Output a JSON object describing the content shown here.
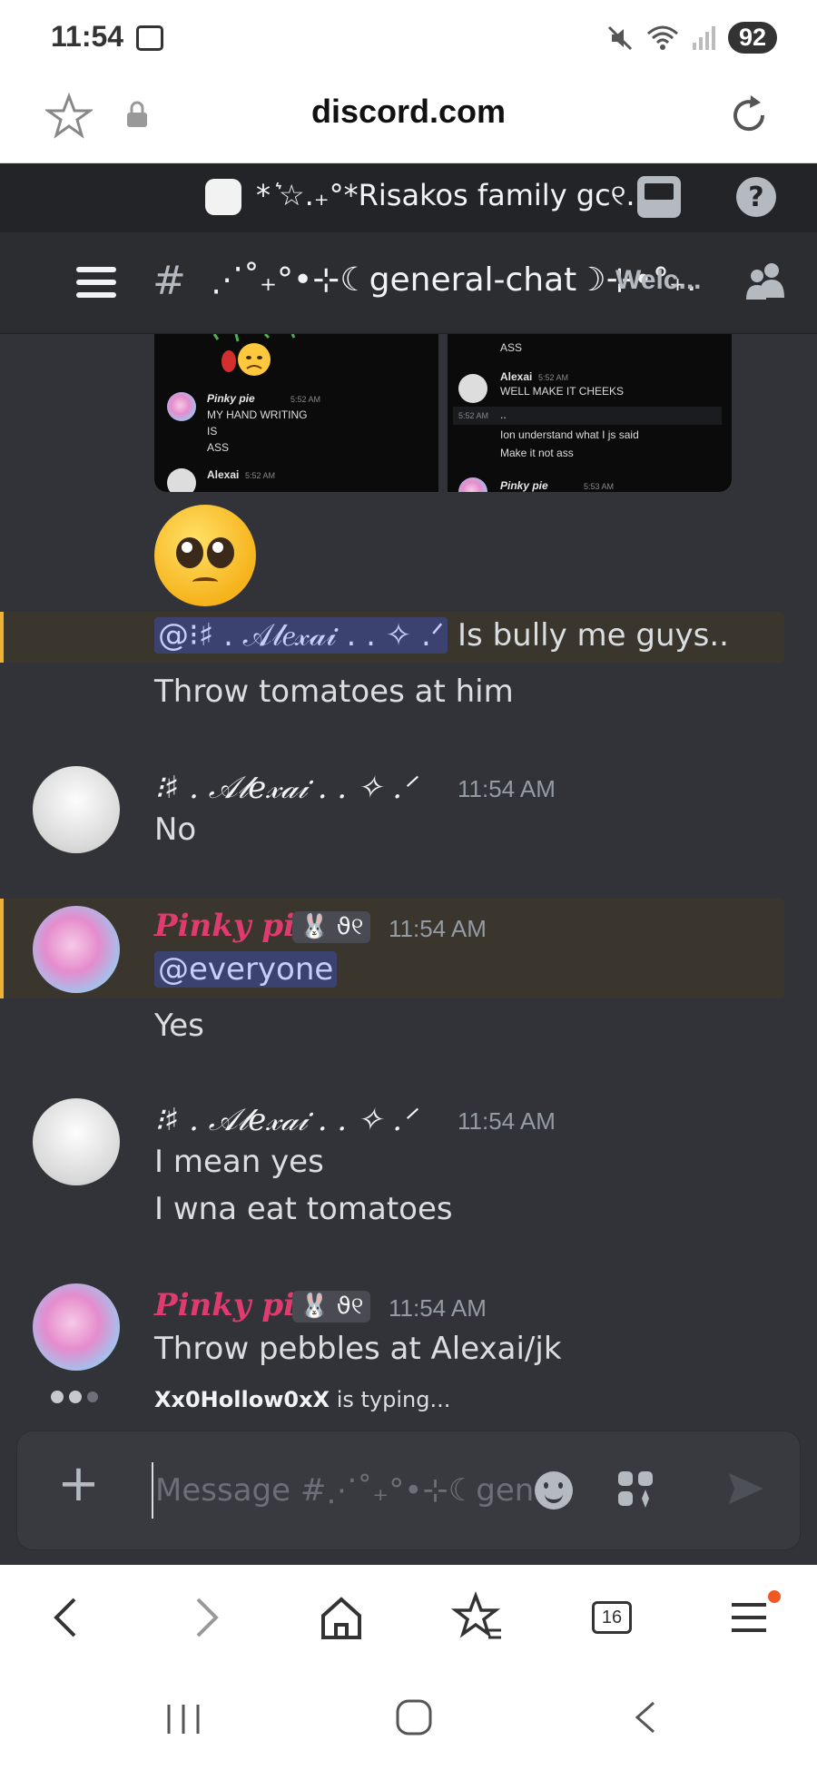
{
  "status_bar": {
    "time": "11:54",
    "battery": "92"
  },
  "browser": {
    "url": "discord.com",
    "tab_count": "16"
  },
  "server": {
    "name": "* ͛☆.₊°*Risakos family gc୧..."
  },
  "channel": {
    "hash": "#",
    "name": "⋰˚₊°•⊹☾general-chat☽⊹•°₊.",
    "topic": "Welc..."
  },
  "preview_images": {
    "left": {
      "author": "Pinky pie",
      "time": "5:52 AM",
      "lines": [
        "MY HAND WRITING",
        "IS",
        "ASS"
      ],
      "next_author": "Alexai",
      "next_time": "5:52 AM"
    },
    "right": {
      "top_line": "ASS",
      "author": "Alexai",
      "time": "5:52 AM",
      "line1": "WELL MAKE IT CHEEKS",
      "gap_time": "5:52 AM",
      "dots": "..",
      "line2": "Ion understand what I js said",
      "line3": "Make it not ass",
      "next_author": "Pinky pie",
      "next_time": "5:53 AM"
    }
  },
  "messages": {
    "m1": {
      "mention": "@⁝♯ . 𝒜𝓁𝑒𝓍𝒶𝒾 . . ✧ .ᐟ",
      "text": " Is bully me guys..",
      "line2": "Throw tomatoes at him"
    },
    "m2": {
      "author": "⁝♯ . 𝒜𝓁𝑒𝓍𝒶𝒾 . . ✧ .ᐟ",
      "time": "11:54 AM",
      "text": "No"
    },
    "m3": {
      "author": "Pinky pie",
      "tag": "🐰 ϑ୧",
      "time": "11:54 AM",
      "mention": "@everyone",
      "line2": "Yes"
    },
    "m4": {
      "author": "⁝♯ . 𝒜𝓁𝑒𝓍𝒶𝒾 . . ✧ .ᐟ",
      "time": "11:54 AM",
      "line1": "I mean yes",
      "line2": "I wna eat tomatoes"
    },
    "m5": {
      "author": "Pinky pie",
      "tag": "🐰 ϑ୧",
      "time": "11:54 AM",
      "text": "Throw pebbles at Alexai/jk"
    }
  },
  "typing": {
    "user": "Xx0Hollow0xX",
    "suffix": " is typing..."
  },
  "composer": {
    "placeholder": "Message #⋰˚₊°•⊹☾general-c"
  },
  "colors": {
    "bg": "#313338",
    "pinky": "#e03b6e",
    "mention_bg": "#3c4270",
    "highlight": "#f0b232"
  }
}
